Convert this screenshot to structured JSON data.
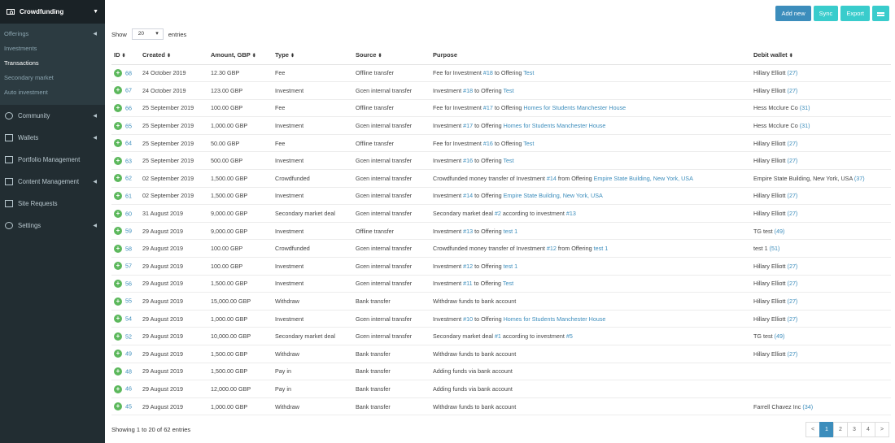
{
  "sidebar": {
    "header": "Crowdfunding",
    "sub_items": [
      {
        "label": "Offerings",
        "active": false
      },
      {
        "label": "Investments",
        "active": false
      },
      {
        "label": "Transactions",
        "active": true
      },
      {
        "label": "Secondary market",
        "active": false
      },
      {
        "label": "Auto investment",
        "active": false
      }
    ],
    "menu": [
      {
        "label": "Community",
        "icon": "community-icon"
      },
      {
        "label": "Wallets",
        "icon": "wallet-icon"
      },
      {
        "label": "Portfolio Management",
        "icon": "portfolio-icon"
      },
      {
        "label": "Content Management",
        "icon": "content-icon"
      },
      {
        "label": "Site Requests",
        "icon": "mail-icon"
      },
      {
        "label": "Settings",
        "icon": "gear-icon"
      }
    ]
  },
  "toolbar": {
    "add_new": "Add new",
    "sync": "Sync",
    "export": "Export"
  },
  "length": {
    "show": "Show",
    "value": "20",
    "entries": "entries"
  },
  "table": {
    "headers": {
      "id": "ID",
      "created": "Created",
      "amount": "Amount, GBP",
      "type": "Type",
      "source": "Source",
      "purpose": "Purpose",
      "debit": "Debit wallet"
    },
    "rows": [
      {
        "id": "68",
        "created": "24 October 2019",
        "amount": "12.30 GBP",
        "type": "Fee",
        "source": "Offline transfer",
        "purpose": [
          [
            "t",
            "Fee for Investment "
          ],
          [
            "l",
            "#18"
          ],
          [
            "t",
            " to Offering "
          ],
          [
            "l",
            "Test"
          ]
        ],
        "debit": "Hillary Elliott",
        "debit_id": "(27)"
      },
      {
        "id": "67",
        "created": "24 October 2019",
        "amount": "123.00 GBP",
        "type": "Investment",
        "source": "Gcen internal transfer",
        "purpose": [
          [
            "t",
            "Investment "
          ],
          [
            "l",
            "#18"
          ],
          [
            "t",
            " to Offering "
          ],
          [
            "l",
            "Test"
          ]
        ],
        "debit": "Hillary Elliott",
        "debit_id": "(27)"
      },
      {
        "id": "66",
        "created": "25 September 2019",
        "amount": "100.00 GBP",
        "type": "Fee",
        "source": "Offline transfer",
        "purpose": [
          [
            "t",
            "Fee for Investment "
          ],
          [
            "l",
            "#17"
          ],
          [
            "t",
            " to Offering "
          ],
          [
            "l",
            "Homes for Students Manchester House"
          ]
        ],
        "debit": "Hess Mcclure Co",
        "debit_id": "(31)"
      },
      {
        "id": "65",
        "created": "25 September 2019",
        "amount": "1,000.00 GBP",
        "type": "Investment",
        "source": "Gcen internal transfer",
        "purpose": [
          [
            "t",
            "Investment "
          ],
          [
            "l",
            "#17"
          ],
          [
            "t",
            " to Offering "
          ],
          [
            "l",
            "Homes for Students Manchester House"
          ]
        ],
        "debit": "Hess Mcclure Co",
        "debit_id": "(31)"
      },
      {
        "id": "64",
        "created": "25 September 2019",
        "amount": "50.00 GBP",
        "type": "Fee",
        "source": "Offline transfer",
        "purpose": [
          [
            "t",
            "Fee for Investment "
          ],
          [
            "l",
            "#16"
          ],
          [
            "t",
            " to Offering "
          ],
          [
            "l",
            "Test"
          ]
        ],
        "debit": "Hillary Elliott",
        "debit_id": "(27)"
      },
      {
        "id": "63",
        "created": "25 September 2019",
        "amount": "500.00 GBP",
        "type": "Investment",
        "source": "Gcen internal transfer",
        "purpose": [
          [
            "t",
            "Investment "
          ],
          [
            "l",
            "#16"
          ],
          [
            "t",
            " to Offering "
          ],
          [
            "l",
            "Test"
          ]
        ],
        "debit": "Hillary Elliott",
        "debit_id": "(27)"
      },
      {
        "id": "62",
        "created": "02 September 2019",
        "amount": "1,500.00 GBP",
        "type": "Crowdfunded",
        "source": "Gcen internal transfer",
        "purpose": [
          [
            "t",
            "Crowdfunded money transfer of Investment "
          ],
          [
            "l",
            "#14"
          ],
          [
            "t",
            " from Offering "
          ],
          [
            "l",
            "Empire State Building, New York, USA"
          ]
        ],
        "debit": "Empire State Building, New York, USA",
        "debit_id": "(37)"
      },
      {
        "id": "61",
        "created": "02 September 2019",
        "amount": "1,500.00 GBP",
        "type": "Investment",
        "source": "Gcen internal transfer",
        "purpose": [
          [
            "t",
            "Investment "
          ],
          [
            "l",
            "#14"
          ],
          [
            "t",
            " to Offering "
          ],
          [
            "l",
            "Empire State Building, New York, USA"
          ]
        ],
        "debit": "Hillary Elliott",
        "debit_id": "(27)"
      },
      {
        "id": "60",
        "created": "31 August 2019",
        "amount": "9,000.00 GBP",
        "type": "Secondary market deal",
        "source": "Gcen internal transfer",
        "purpose": [
          [
            "t",
            "Secondary market deal "
          ],
          [
            "l",
            "#2"
          ],
          [
            "t",
            " according to investment "
          ],
          [
            "l",
            "#13"
          ]
        ],
        "debit": "Hillary Elliott",
        "debit_id": "(27)"
      },
      {
        "id": "59",
        "created": "29 August 2019",
        "amount": "9,000.00 GBP",
        "type": "Investment",
        "source": "Offline transfer",
        "purpose": [
          [
            "t",
            "Investment "
          ],
          [
            "l",
            "#13"
          ],
          [
            "t",
            " to Offering "
          ],
          [
            "l",
            "test 1"
          ]
        ],
        "debit": "TG test",
        "debit_id": "(49)"
      },
      {
        "id": "58",
        "created": "29 August 2019",
        "amount": "100.00 GBP",
        "type": "Crowdfunded",
        "source": "Gcen internal transfer",
        "purpose": [
          [
            "t",
            "Crowdfunded money transfer of Investment "
          ],
          [
            "l",
            "#12"
          ],
          [
            "t",
            " from Offering "
          ],
          [
            "l",
            "test 1"
          ]
        ],
        "debit": "test 1",
        "debit_id": "(51)"
      },
      {
        "id": "57",
        "created": "29 August 2019",
        "amount": "100.00 GBP",
        "type": "Investment",
        "source": "Gcen internal transfer",
        "purpose": [
          [
            "t",
            "Investment "
          ],
          [
            "l",
            "#12"
          ],
          [
            "t",
            " to Offering "
          ],
          [
            "l",
            "test 1"
          ]
        ],
        "debit": "Hillary Elliott",
        "debit_id": "(27)"
      },
      {
        "id": "56",
        "created": "29 August 2019",
        "amount": "1,500.00 GBP",
        "type": "Investment",
        "source": "Gcen internal transfer",
        "purpose": [
          [
            "t",
            "Investment "
          ],
          [
            "l",
            "#11"
          ],
          [
            "t",
            " to Offering "
          ],
          [
            "l",
            "Test"
          ]
        ],
        "debit": "Hillary Elliott",
        "debit_id": "(27)"
      },
      {
        "id": "55",
        "created": "29 August 2019",
        "amount": "15,000.00 GBP",
        "type": "Withdraw",
        "source": "Bank transfer",
        "purpose": [
          [
            "t",
            "Withdraw funds to bank account"
          ]
        ],
        "debit": "Hillary Elliott",
        "debit_id": "(27)"
      },
      {
        "id": "54",
        "created": "29 August 2019",
        "amount": "1,000.00 GBP",
        "type": "Investment",
        "source": "Gcen internal transfer",
        "purpose": [
          [
            "t",
            "Investment "
          ],
          [
            "l",
            "#10"
          ],
          [
            "t",
            " to Offering "
          ],
          [
            "l",
            "Homes for Students Manchester House"
          ]
        ],
        "debit": "Hillary Elliott",
        "debit_id": "(27)"
      },
      {
        "id": "52",
        "created": "29 August 2019",
        "amount": "10,000.00 GBP",
        "type": "Secondary market deal",
        "source": "Gcen internal transfer",
        "purpose": [
          [
            "t",
            "Secondary market deal "
          ],
          [
            "l",
            "#1"
          ],
          [
            "t",
            " according to investment "
          ],
          [
            "l",
            "#5"
          ]
        ],
        "debit": "TG test",
        "debit_id": "(49)"
      },
      {
        "id": "49",
        "created": "29 August 2019",
        "amount": "1,500.00 GBP",
        "type": "Withdraw",
        "source": "Bank transfer",
        "purpose": [
          [
            "t",
            "Withdraw funds to bank account"
          ]
        ],
        "debit": "Hillary Elliott",
        "debit_id": "(27)"
      },
      {
        "id": "48",
        "created": "29 August 2019",
        "amount": "1,500.00 GBP",
        "type": "Pay in",
        "source": "Bank transfer",
        "purpose": [
          [
            "t",
            "Adding funds via bank account"
          ]
        ],
        "debit": "",
        "debit_id": ""
      },
      {
        "id": "46",
        "created": "29 August 2019",
        "amount": "12,000.00 GBP",
        "type": "Pay in",
        "source": "Bank transfer",
        "purpose": [
          [
            "t",
            "Adding funds via bank account"
          ]
        ],
        "debit": "",
        "debit_id": ""
      },
      {
        "id": "45",
        "created": "29 August 2019",
        "amount": "1,000.00 GBP",
        "type": "Withdraw",
        "source": "Bank transfer",
        "purpose": [
          [
            "t",
            "Withdraw funds to bank account"
          ]
        ],
        "debit": "Farrell Chavez Inc",
        "debit_id": "(34)"
      }
    ]
  },
  "footer": {
    "info": "Showing 1 to 20 of 62 entries"
  },
  "pagination": {
    "prev": "<",
    "pages": [
      "1",
      "2",
      "3",
      "4"
    ],
    "active": "1",
    "next": ">"
  },
  "colors": {
    "sidebar": "#222d32",
    "primary": "#3c8dbc",
    "teal": "#39cccc",
    "plus": "#5cb85c"
  }
}
